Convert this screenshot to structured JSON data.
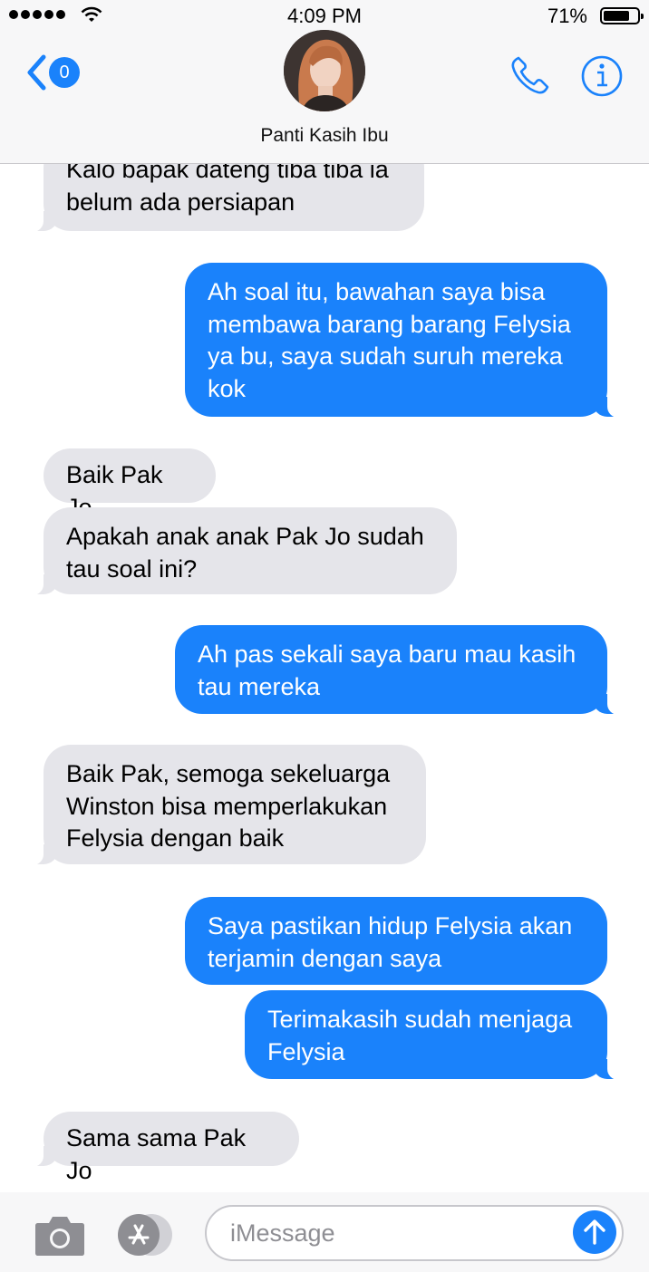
{
  "status_bar": {
    "time": "4:09 PM",
    "battery": "71%"
  },
  "header": {
    "back_count": "0",
    "contact_name": "Panti Kasih Ibu"
  },
  "messages": [
    {
      "dir": "in",
      "text": "Kalo bapak dateng tiba tiba ia\nbelum ada persiapan"
    },
    {
      "dir": "out",
      "text": "Ah soal itu, bawahan saya bisa\nmembawa barang barang Felysia\nya bu, saya sudah suruh mereka\nkok"
    },
    {
      "dir": "in",
      "text": "Baik Pak Jo"
    },
    {
      "dir": "in",
      "text": "Apakah anak anak Pak Jo sudah\ntau soal ini?"
    },
    {
      "dir": "out",
      "text": "Ah pas sekali saya baru mau kasih\ntau mereka"
    },
    {
      "dir": "in",
      "text": "Baik Pak, semoga sekeluarga\nWinston bisa memperlakukan\nFelysia dengan baik"
    },
    {
      "dir": "out",
      "text": "Saya pastikan hidup Felysia akan\nterjamin dengan saya"
    },
    {
      "dir": "out",
      "text": "Terimakasih sudah menjaga\nFelysia"
    },
    {
      "dir": "in",
      "text": "Sama sama Pak Jo"
    }
  ],
  "composer": {
    "placeholder": "iMessage"
  },
  "colors": {
    "accent": "#1a82fb",
    "incoming_bubble": "#e5e5ea",
    "header_bg": "#f7f7f8"
  },
  "icons": [
    "back-chevron-icon",
    "phone-icon",
    "info-icon",
    "camera-icon",
    "app-store-icon",
    "send-arrow-icon",
    "wifi-icon",
    "battery-icon"
  ]
}
